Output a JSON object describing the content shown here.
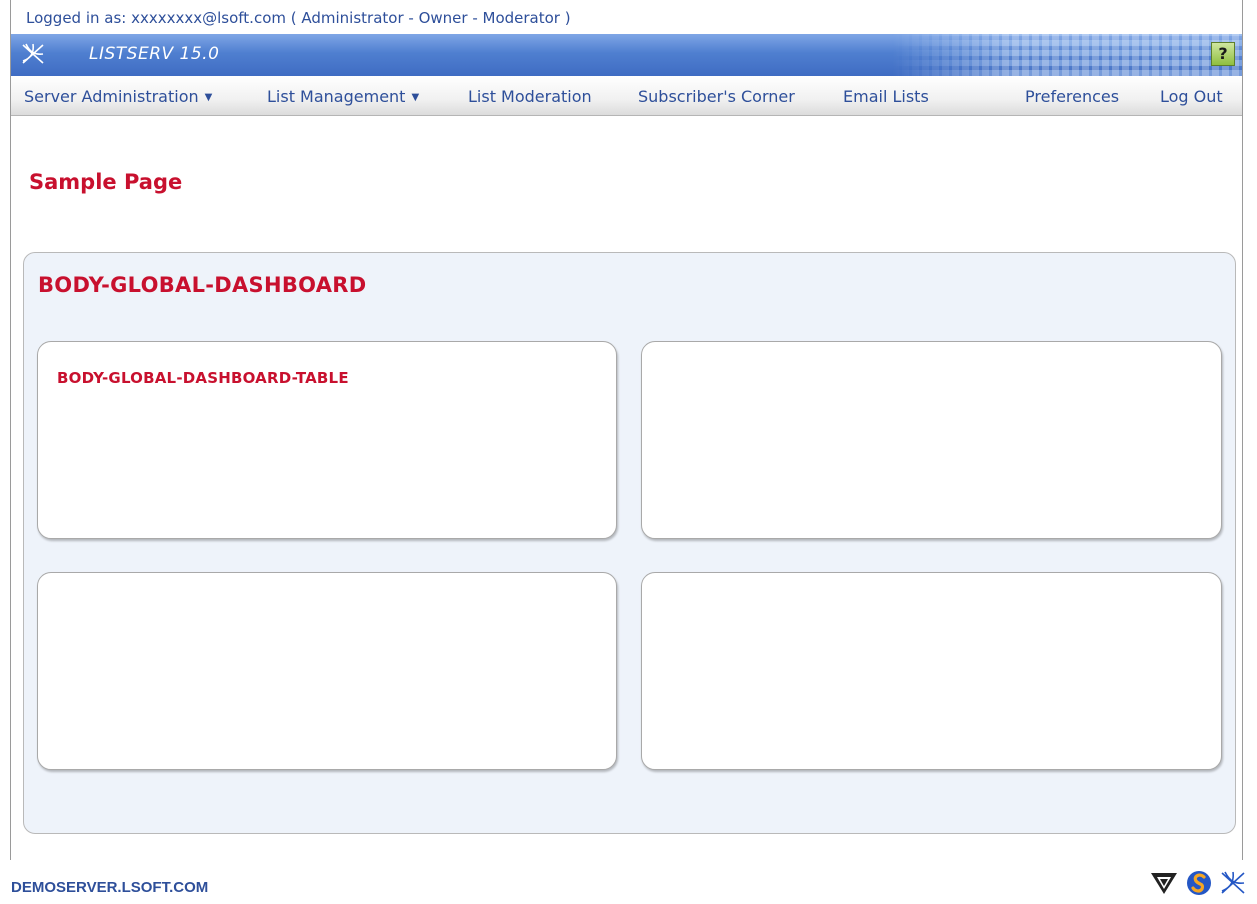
{
  "header": {
    "login_text": "Logged in as: xxxxxxxx@lsoft.com ( Administrator - Owner - Moderator )",
    "app_name": "LISTSERV 15.0",
    "help_label": "?"
  },
  "nav": {
    "items": [
      {
        "label": "Server Administration",
        "has_dropdown": true
      },
      {
        "label": "List Management",
        "has_dropdown": true
      },
      {
        "label": "List Moderation",
        "has_dropdown": false
      },
      {
        "label": "Subscriber's Corner",
        "has_dropdown": false
      },
      {
        "label": "Email Lists",
        "has_dropdown": false
      }
    ],
    "right_items": [
      {
        "label": "Preferences"
      },
      {
        "label": "Log Out"
      }
    ],
    "dropdown_glyph": "▼"
  },
  "main": {
    "page_title": "Sample Page",
    "dashboard_title": "BODY-GLOBAL-DASHBOARD",
    "widgets": [
      {
        "title": "BODY-GLOBAL-DASHBOARD-TABLE"
      },
      {
        "title": ""
      },
      {
        "title": ""
      },
      {
        "title": ""
      }
    ]
  },
  "footer": {
    "server_name": "DEMOSERVER.LSOFT.COM",
    "logos": [
      "triangle-logo-icon",
      "s-globe-logo-icon",
      "listserv-logo-icon"
    ]
  },
  "colors": {
    "title_red": "#c8102e",
    "link_blue": "#2e4f9a",
    "banner_blue": "#4f7fd0",
    "panel_bg": "#eef3fa"
  }
}
